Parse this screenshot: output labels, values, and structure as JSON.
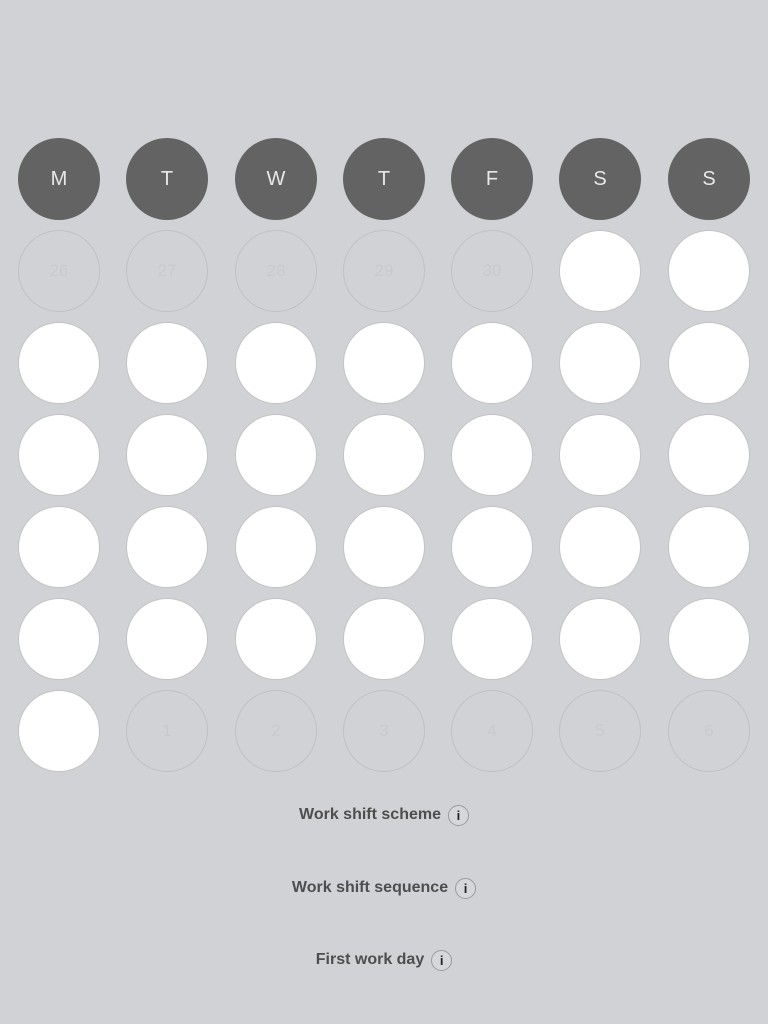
{
  "weekdays": [
    "M",
    "T",
    "W",
    "T",
    "F",
    "S",
    "S"
  ],
  "weeks": [
    [
      {
        "label": "26",
        "muted": true
      },
      {
        "label": "27",
        "muted": true
      },
      {
        "label": "28",
        "muted": true
      },
      {
        "label": "29",
        "muted": true
      },
      {
        "label": "30",
        "muted": true
      },
      {
        "label": "",
        "muted": false
      },
      {
        "label": "",
        "muted": false
      }
    ],
    [
      {
        "label": "",
        "muted": false
      },
      {
        "label": "",
        "muted": false
      },
      {
        "label": "",
        "muted": false
      },
      {
        "label": "",
        "muted": false
      },
      {
        "label": "",
        "muted": false
      },
      {
        "label": "",
        "muted": false
      },
      {
        "label": "",
        "muted": false
      }
    ],
    [
      {
        "label": "",
        "muted": false
      },
      {
        "label": "",
        "muted": false
      },
      {
        "label": "",
        "muted": false
      },
      {
        "label": "",
        "muted": false
      },
      {
        "label": "",
        "muted": false
      },
      {
        "label": "",
        "muted": false
      },
      {
        "label": "",
        "muted": false
      }
    ],
    [
      {
        "label": "",
        "muted": false
      },
      {
        "label": "",
        "muted": false
      },
      {
        "label": "",
        "muted": false
      },
      {
        "label": "",
        "muted": false
      },
      {
        "label": "",
        "muted": false
      },
      {
        "label": "",
        "muted": false
      },
      {
        "label": "",
        "muted": false
      }
    ],
    [
      {
        "label": "",
        "muted": false
      },
      {
        "label": "",
        "muted": false
      },
      {
        "label": "",
        "muted": false
      },
      {
        "label": "",
        "muted": false
      },
      {
        "label": "",
        "muted": false
      },
      {
        "label": "",
        "muted": false
      },
      {
        "label": "",
        "muted": false
      }
    ],
    [
      {
        "label": "",
        "muted": false
      },
      {
        "label": "1",
        "muted": true
      },
      {
        "label": "2",
        "muted": true
      },
      {
        "label": "3",
        "muted": true
      },
      {
        "label": "4",
        "muted": true
      },
      {
        "label": "5",
        "muted": true
      },
      {
        "label": "6",
        "muted": true
      }
    ]
  ],
  "settings": {
    "scheme_label": "Work shift scheme",
    "sequence_label": "Work shift sequence",
    "first_day_label": "First work day",
    "info_glyph": "i"
  },
  "colors": {
    "background": "#d1d2d6",
    "weekday_fill": "#636363",
    "day_fill": "#ffffff"
  }
}
